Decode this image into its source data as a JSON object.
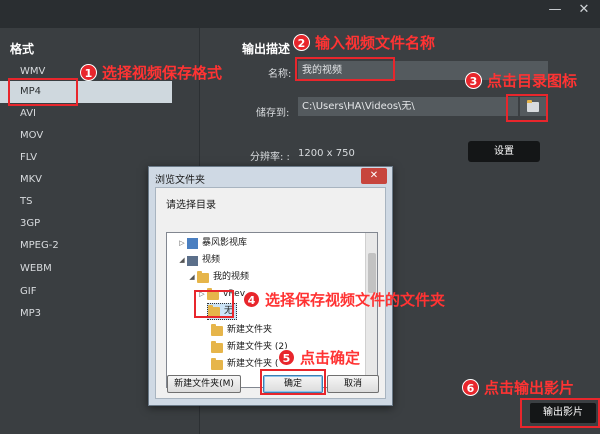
{
  "window": {
    "minimize_glyph": "—",
    "close_glyph": "✕"
  },
  "formats": {
    "title": "格式",
    "items": [
      "WMV",
      "MP4",
      "AVI",
      "MOV",
      "FLV",
      "MKV",
      "TS",
      "3GP",
      "MPEG-2",
      "WEBM",
      "GIF",
      "MP3"
    ],
    "selected": "MP4"
  },
  "output": {
    "title": "输出描述",
    "name_label": "名称:",
    "name_value": "我的视频",
    "save_label": "储存到:",
    "save_path": "C:\\Users\\HA\\Videos\\无\\",
    "resolution_label": "分辨率: :",
    "resolution_value": "1200 x 750",
    "settings_button": "设置",
    "export_button": "输出影片"
  },
  "dialog": {
    "title": "浏览文件夹",
    "close_glyph": "✕",
    "prompt": "请选择目录",
    "tree": [
      {
        "label": "暴风影视库",
        "icon": "library-icon",
        "expanded": false
      },
      {
        "label": "视频",
        "icon": "video-library-icon",
        "expanded": true
      },
      {
        "label": "我的视频",
        "icon": "folder-icon",
        "expanded": true
      },
      {
        "label": "vRev",
        "icon": "folder-icon",
        "expanded": false
      },
      {
        "label": "无",
        "icon": "folder-icon",
        "expanded": false,
        "selected": true
      },
      {
        "label": "新建文件夹",
        "icon": "folder-icon",
        "expanded": false
      },
      {
        "label": "新建文件夹 (2)",
        "icon": "folder-icon",
        "expanded": false
      },
      {
        "label": "新建文件夹 (",
        "icon": "folder-icon",
        "expanded": false
      }
    ],
    "new_folder_button": "新建文件夹(M)",
    "ok_button": "确定",
    "cancel_button": "取消"
  },
  "annotations": [
    {
      "num": "1",
      "text": "选择视频保存格式"
    },
    {
      "num": "2",
      "text": "输入视频文件名称"
    },
    {
      "num": "3",
      "text": "点击目录图标"
    },
    {
      "num": "4",
      "text": "选择保存视频文件的文件夹"
    },
    {
      "num": "5",
      "text": "点击确定"
    },
    {
      "num": "6",
      "text": "点击输出影片"
    }
  ],
  "colors": {
    "annotation": "#e8262c",
    "selected_format_bg": "#cfd8de",
    "panel_bg": "#3b3f42"
  }
}
